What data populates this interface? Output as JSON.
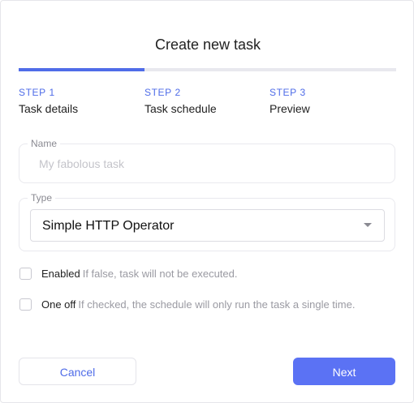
{
  "dialog": {
    "title": "Create new task"
  },
  "progress": {
    "fraction": 0.333,
    "accent": "#4f6ce8"
  },
  "steps": [
    {
      "number": "STEP 1",
      "label": "Task details"
    },
    {
      "number": "STEP 2",
      "label": "Task schedule"
    },
    {
      "number": "STEP 3",
      "label": "Preview"
    }
  ],
  "fields": {
    "name": {
      "legend": "Name",
      "placeholder": "My fabolous task",
      "value": ""
    },
    "type": {
      "legend": "Type",
      "selected": "Simple HTTP Operator"
    }
  },
  "options": {
    "enabled": {
      "label": "Enabled",
      "hint": "If false, task will not be executed.",
      "checked": false
    },
    "one_off": {
      "label": "One off",
      "hint": "If checked, the schedule will only run the task a single time.",
      "checked": false
    }
  },
  "actions": {
    "cancel_label": "Cancel",
    "next_label": "Next",
    "next_color": "#5b72f4"
  },
  "icons": {
    "select_caret": "caret-down-icon"
  }
}
